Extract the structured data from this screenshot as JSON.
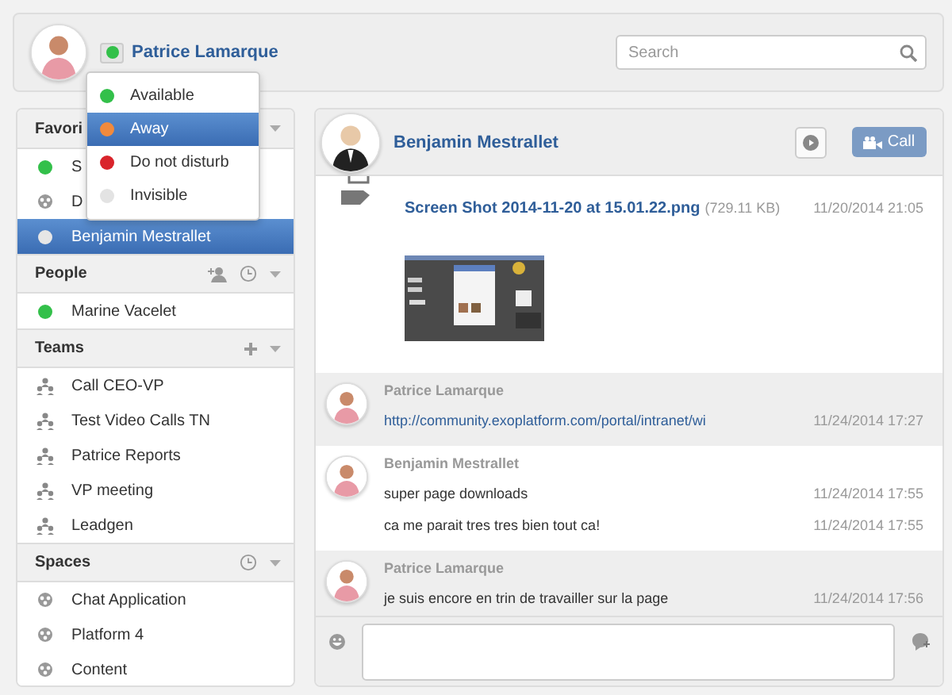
{
  "header": {
    "user_name": "Patrice Lamarque",
    "search": {
      "placeholder": "Search"
    }
  },
  "status_menu": [
    {
      "label": "Available",
      "color": "#33c04a",
      "selected": false
    },
    {
      "label": "Away",
      "color": "#f28a3c",
      "selected": true
    },
    {
      "label": "Do not disturb",
      "color": "#d9242b",
      "selected": false
    },
    {
      "label": "Invisible",
      "color": "#e3e3e3",
      "selected": false
    }
  ],
  "sidebar": {
    "sections": [
      {
        "title": "Favori",
        "items": [
          {
            "label": "S",
            "kind": "status",
            "color": "#33c04a",
            "selected": false
          },
          {
            "label": "D",
            "kind": "space",
            "selected": false
          },
          {
            "label": "Benjamin Mestrallet",
            "kind": "status",
            "color": "#e6e6e6",
            "selected": true
          }
        ]
      },
      {
        "title": "People",
        "tools": [
          {
            "kind": "add-person"
          },
          {
            "kind": "history"
          }
        ],
        "items": [
          {
            "label": "Marine Vacelet",
            "kind": "status",
            "color": "#33c04a",
            "selected": false
          }
        ]
      },
      {
        "title": "Teams",
        "tools": [
          {
            "kind": "add"
          }
        ],
        "items": [
          {
            "label": "Call CEO-VP",
            "kind": "team",
            "selected": false
          },
          {
            "label": "Test Video Calls TN",
            "kind": "team",
            "selected": false
          },
          {
            "label": "Patrice Reports",
            "kind": "team",
            "selected": false
          },
          {
            "label": "VP meeting",
            "kind": "team",
            "selected": false
          },
          {
            "label": "Leadgen",
            "kind": "team",
            "selected": false
          }
        ]
      },
      {
        "title": "Spaces",
        "tools": [
          {
            "kind": "history"
          }
        ],
        "items": [
          {
            "label": "Chat Application",
            "kind": "space",
            "selected": false
          },
          {
            "label": "Platform 4",
            "kind": "space",
            "selected": false
          },
          {
            "label": "Content",
            "kind": "space",
            "selected": false
          }
        ]
      }
    ]
  },
  "conversation": {
    "title": "Benjamin Mestrallet",
    "buttons": [
      {
        "kind": "play"
      },
      {
        "kind": "call",
        "label": "Call"
      }
    ],
    "messages": [
      {
        "kind": "file",
        "shaded": false,
        "file_name": "Screen Shot 2014-11-20 at 15.01.22.png",
        "file_size": "(729.11 KB)",
        "time": "11/20/2014 21:05"
      },
      {
        "kind": "text",
        "shaded": true,
        "author": "Patrice Lamarque",
        "lines": [
          {
            "kind": "link",
            "text": "http://community.exoplatform.com/portal/intranet/wi",
            "time": "11/24/2014 17:27"
          }
        ]
      },
      {
        "kind": "text",
        "shaded": false,
        "author": "Benjamin Mestrallet",
        "lines": [
          {
            "kind": "text",
            "text": "super page downloads",
            "time": "11/24/2014 17:55"
          },
          {
            "kind": "text",
            "text": "ca me parait tres tres bien tout ca!",
            "time": "11/24/2014 17:55"
          }
        ]
      },
      {
        "kind": "text",
        "shaded": true,
        "author": "Patrice Lamarque",
        "lines": [
          {
            "kind": "text",
            "text": "je suis encore en trin de travailler sur la page",
            "time": "11/24/2014 17:56"
          }
        ]
      }
    ]
  }
}
